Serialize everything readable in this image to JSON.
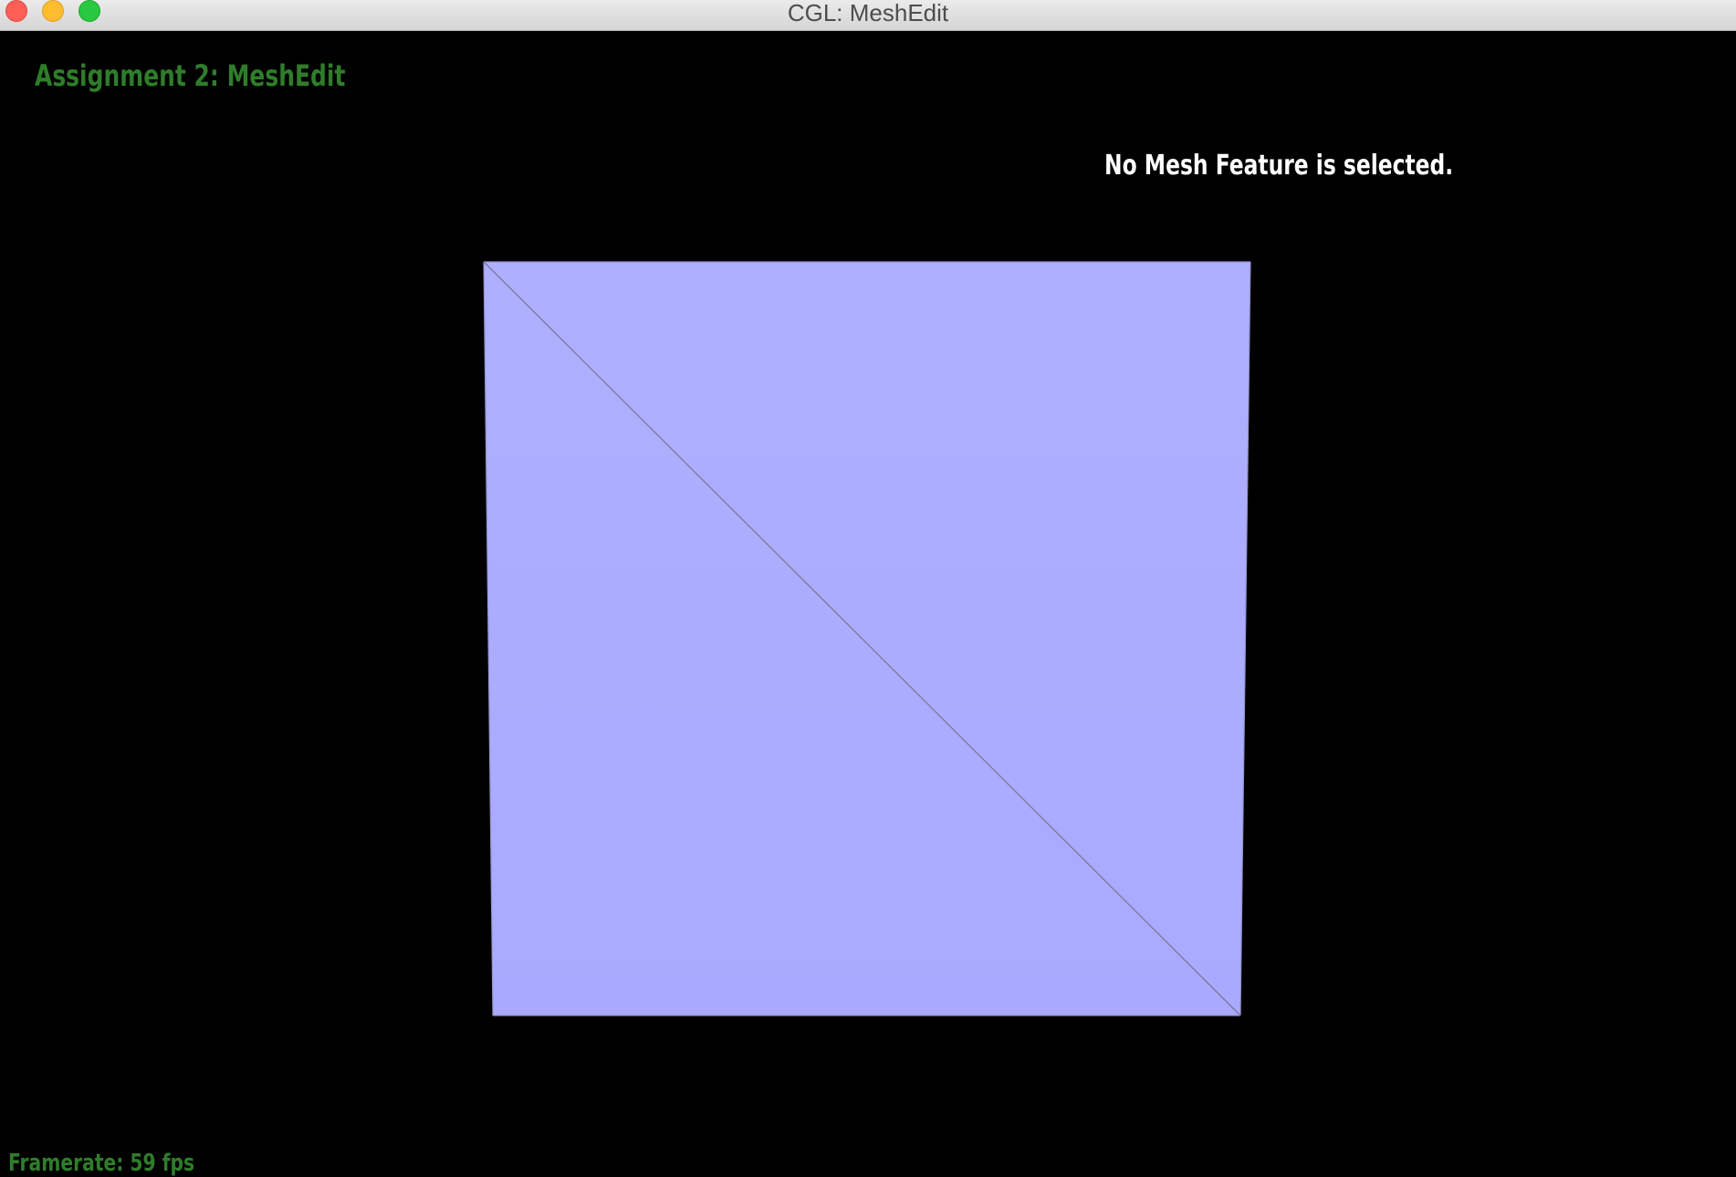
{
  "window": {
    "title": "CGL: MeshEdit",
    "buttons": [
      "close-button",
      "minimize-button",
      "zoom-button"
    ]
  },
  "app": {
    "title": "Assignment 2: MeshEdit",
    "status": "No Mesh Feature is selected.",
    "framerate": "Framerate: 59 fps"
  },
  "mesh": {
    "faces": 2,
    "edges": 5,
    "vertices": 4,
    "face_color": "#aaaaff",
    "edge_color": "#7a7a9a",
    "background": "#000000"
  },
  "colors": {
    "accent_green": "#2f7d2a",
    "status_text": "#ffffff"
  }
}
